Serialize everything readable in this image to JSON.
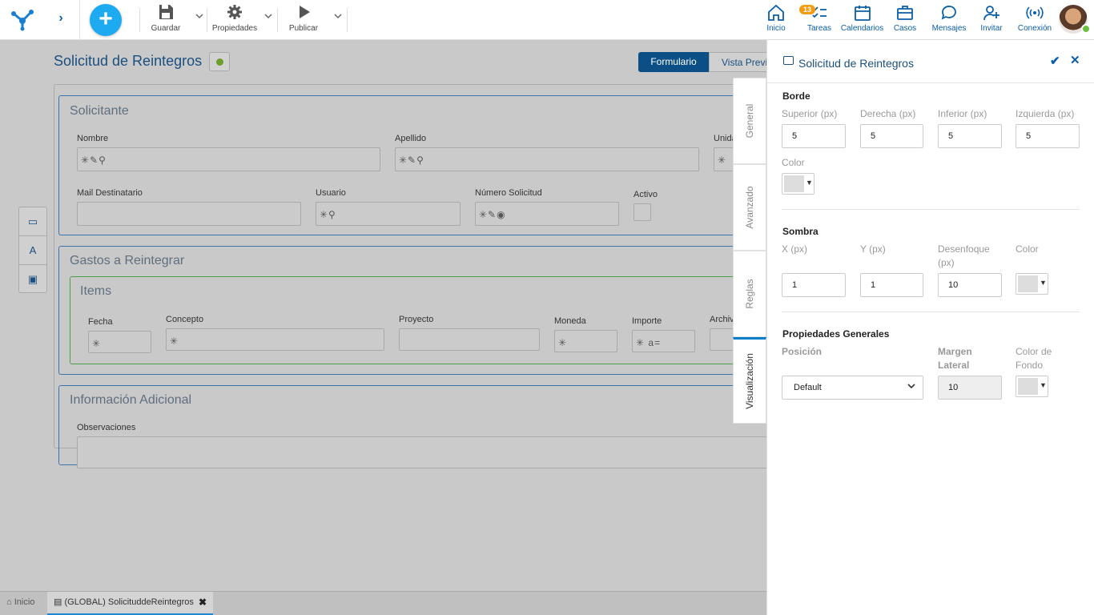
{
  "toolbar": {
    "save_label": "Guardar",
    "properties_label": "Propiedades",
    "publish_label": "Publicar"
  },
  "nav": {
    "home": "Inicio",
    "tasks": "Tareas",
    "tasks_badge": "13",
    "calendars": "Calendarios",
    "cases": "Casos",
    "messages": "Mensajes",
    "invite": "Invitar",
    "connection": "Conexión"
  },
  "form": {
    "title": "Solicitud de Reintegros",
    "tab_form": "Formulario",
    "tab_preview": "Vista Previ",
    "sections": {
      "solicitante": {
        "title": "Solicitante",
        "fields": [
          "Nombre",
          "Apellido",
          "Unida",
          "Mail Destinatario",
          "Usuario",
          "Número Solicitud",
          "Activo"
        ]
      },
      "gastos": {
        "title": "Gastos a Reintegrar",
        "grid_title": "Items",
        "columns": [
          "Fecha",
          "Concepto",
          "Proyecto",
          "Moneda",
          "Importe",
          "Archiv"
        ]
      },
      "info": {
        "title": "Información Adicional",
        "fields": [
          "Observaciones"
        ]
      }
    }
  },
  "vertical_tabs": [
    "General",
    "Avanzado",
    "Reglas",
    "Visualización"
  ],
  "taskbar": {
    "home": "Inicio",
    "tab": "(GLOBAL) SolicituddeReintegros"
  },
  "panel": {
    "title": "Solicitud de Reintegros",
    "border": {
      "heading": "Borde",
      "top_label": "Superior (px)",
      "right_label": "Derecha (px)",
      "bottom_label": "Inferior (px)",
      "left_label": "Izquierda (px)",
      "top": "5",
      "right": "5",
      "bottom": "5",
      "left": "5",
      "color_label": "Color"
    },
    "shadow": {
      "heading": "Sombra",
      "x_label": "X (px)",
      "y_label": "Y (px)",
      "blur_label": "Desenfoque (px)",
      "color_label": "Color",
      "x": "1",
      "y": "1",
      "blur": "10"
    },
    "general": {
      "heading": "Propiedades Generales",
      "position_label": "Posición",
      "margin_label": "Margen Lateral",
      "bg_label": "Color de Fondo",
      "position": "Default",
      "margin": "10"
    }
  },
  "colors": {
    "accent": "#0b4f86",
    "link": "#0a5fa8",
    "add_button": "#1eaaf1",
    "badge": "#f39c12",
    "online": "#6cbf43"
  }
}
